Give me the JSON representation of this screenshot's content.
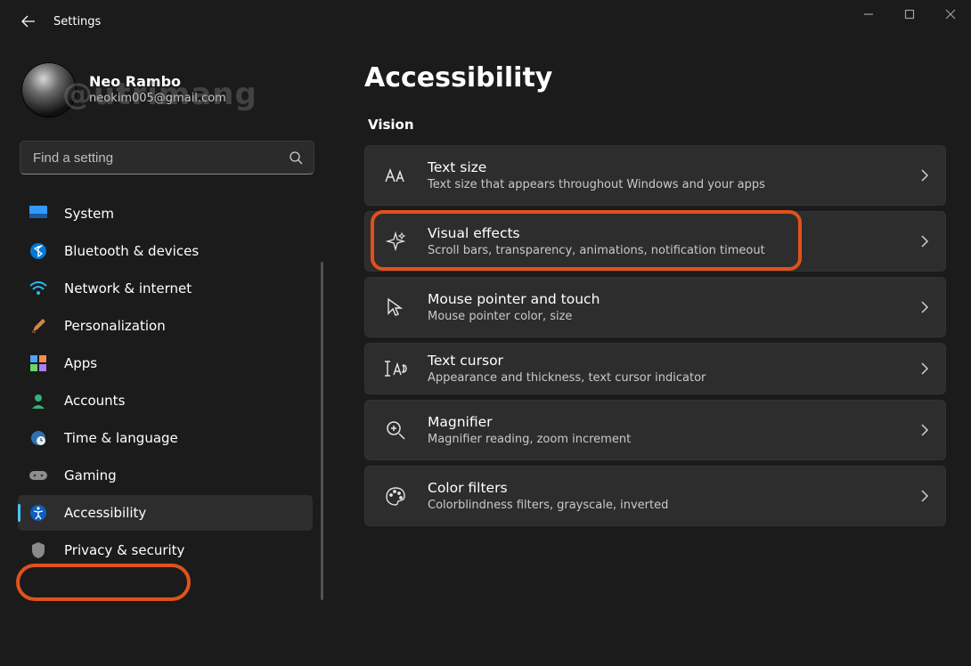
{
  "window": {
    "title": "Settings"
  },
  "profile": {
    "name": "Neo Rambo",
    "email": "neokim005@gmail.com"
  },
  "watermark": "@utrimang",
  "search": {
    "placeholder": "Find a setting"
  },
  "sidebar": {
    "items": [
      {
        "key": "system",
        "label": "System"
      },
      {
        "key": "bluetooth",
        "label": "Bluetooth & devices"
      },
      {
        "key": "network",
        "label": "Network & internet"
      },
      {
        "key": "personalization",
        "label": "Personalization"
      },
      {
        "key": "apps",
        "label": "Apps"
      },
      {
        "key": "accounts",
        "label": "Accounts"
      },
      {
        "key": "time",
        "label": "Time & language"
      },
      {
        "key": "gaming",
        "label": "Gaming"
      },
      {
        "key": "accessibility",
        "label": "Accessibility"
      },
      {
        "key": "privacy",
        "label": "Privacy & security"
      }
    ],
    "active": "accessibility"
  },
  "page": {
    "title": "Accessibility",
    "section": "Vision",
    "items": [
      {
        "key": "text-size",
        "title": "Text size",
        "sub": "Text size that appears throughout Windows and your apps"
      },
      {
        "key": "visual-effects",
        "title": "Visual effects",
        "sub": "Scroll bars, transparency, animations, notification timeout"
      },
      {
        "key": "mouse-pointer",
        "title": "Mouse pointer and touch",
        "sub": "Mouse pointer color, size"
      },
      {
        "key": "text-cursor",
        "title": "Text cursor",
        "sub": "Appearance and thickness, text cursor indicator"
      },
      {
        "key": "magnifier",
        "title": "Magnifier",
        "sub": "Magnifier reading, zoom increment"
      },
      {
        "key": "color-filters",
        "title": "Color filters",
        "sub": "Colorblindness filters, grayscale, inverted"
      }
    ],
    "highlighted": "visual-effects",
    "highlighted_nav": "accessibility"
  }
}
